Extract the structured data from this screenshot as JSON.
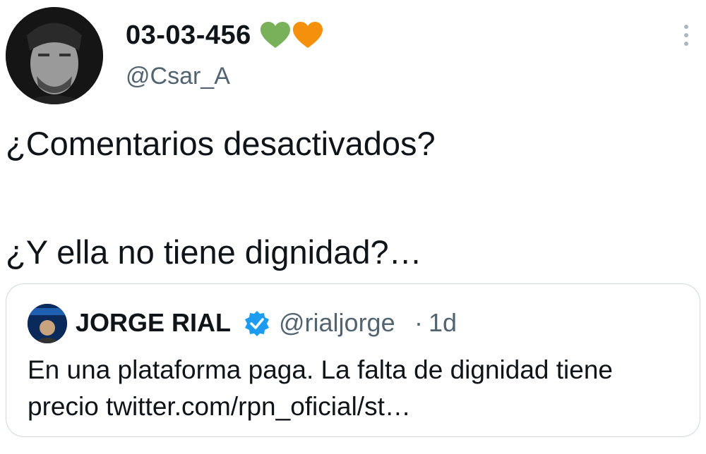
{
  "tweet": {
    "author": {
      "display_name": "03-03-456",
      "handle": "@Csar_A",
      "hearts": [
        {
          "icon": "green-heart-icon",
          "color": "#78b159"
        },
        {
          "icon": "orange-heart-icon",
          "color": "#f4900c"
        }
      ]
    },
    "more_icon": "more-vertical-icon",
    "text_line_1": "¿Comentarios desactivados?",
    "text_line_2": "¿Y ella no tiene dignidad?…"
  },
  "quoted_tweet": {
    "display_name": "JORGE RIAL",
    "verified": true,
    "verified_color": "#1d9bf0",
    "handle": "@rialjorge",
    "separator": "·",
    "time": "1d",
    "text_line_1": "En una plataforma paga. La falta de dignidad tiene",
    "text_line_2": "precio twitter.com/rpn_oficial/st…"
  }
}
